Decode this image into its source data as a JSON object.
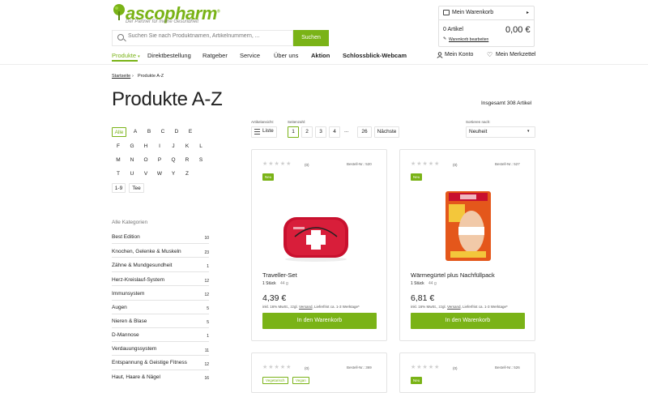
{
  "brand": {
    "name_a": "asco",
    "name_b": "pharm",
    "reg": "®",
    "tagline": "Der Partner für meine Gesundheit"
  },
  "search": {
    "placeholder": "Suchen Sie nach Produktnamen, Artikelnummern, ...",
    "button": "Suchen"
  },
  "cart": {
    "title": "Mein Warenkorb",
    "count": "0 Artikel",
    "total": "0,00 €",
    "edit": "Warenkorb bearbeiten"
  },
  "nav": {
    "items": [
      "Produkte",
      "Direktbestellung",
      "Ratgeber",
      "Service",
      "Über uns",
      "Aktion",
      "Schlossblick-Webcam"
    ],
    "account": "Mein Konto",
    "wishlist": "Mein Merkzettel"
  },
  "breadcrumb": {
    "home": "Startseite",
    "sep": "›",
    "current": "Produkte A-Z"
  },
  "page": {
    "title": "Produkte A-Z",
    "total": "Insgesamt 308 Artikel"
  },
  "letters": {
    "all": "Alle",
    "items": [
      "A",
      "B",
      "C",
      "D",
      "E",
      "F",
      "G",
      "H",
      "I",
      "J",
      "K",
      "L",
      "M",
      "N",
      "O",
      "P",
      "Q",
      "R",
      "S",
      "T",
      "U",
      "V",
      "W",
      "Y",
      "Z",
      "1-9",
      "Tee"
    ]
  },
  "categories": {
    "heading": "Alle Kategorien",
    "items": [
      {
        "name": "Best Edition",
        "count": "10"
      },
      {
        "name": "Knochen, Gelenke & Muskeln",
        "count": "23"
      },
      {
        "name": "Zähne & Mundgesundheit",
        "count": "1"
      },
      {
        "name": "Herz-Kreislauf-System",
        "count": "12"
      },
      {
        "name": "Immunsystem",
        "count": "12"
      },
      {
        "name": "Augen",
        "count": "5"
      },
      {
        "name": "Nieren & Blase",
        "count": "5"
      },
      {
        "name": "D-Mannose",
        "count": "1"
      },
      {
        "name": "Verdauungssystem",
        "count": "11"
      },
      {
        "name": "Entspannung & Geistige Fitness",
        "count": "12"
      },
      {
        "name": "Haut, Haare & Nägel",
        "count": "16"
      }
    ]
  },
  "toolbar": {
    "view_label": "Artikelansicht:",
    "view_value": "Liste",
    "page_label": "Seitenzahl:",
    "pages": [
      "1",
      "2",
      "3",
      "4",
      "...",
      "26"
    ],
    "next": "Nächste",
    "sort_label": "Sortieren nach:",
    "sort_value": "Neuheit"
  },
  "products": [
    {
      "stars": "★★★★★",
      "rating": "(0)",
      "bnr": "Bestell-Nr.: 520",
      "badge": "Neu",
      "name": "Traveller-Set",
      "qty": "1 Stück",
      "weight": "44 g",
      "price": "4,39 €",
      "info_a": "inkl. 16% MwSt., zzgl.",
      "info_link": "Versand",
      "info_b": ", Lieferfrist ca. 1-3 Werktage*",
      "button": "In den Warenkorb"
    },
    {
      "stars": "★★★★★",
      "rating": "(0)",
      "bnr": "Bestell-Nr.: 527",
      "badge": "Neu",
      "name": "Wärmegürtel plus Nachfüllpack",
      "qty": "1 Stück",
      "weight": "44 g",
      "price": "6,81 €",
      "info_a": "inkl. 16% MwSt., zzgl.",
      "info_link": "Versand",
      "info_b": ", Lieferfrist ca. 1-3 Werktage*",
      "button": "In den Warenkorb"
    },
    {
      "stars": "★★★★★",
      "rating": "(0)",
      "bnr": "Bestell-Nr.: 369",
      "badge_a": "Vegetarisch",
      "badge_b": "Vegan"
    },
    {
      "stars": "★★★★★",
      "rating": "(0)",
      "bnr": "Bestell-Nr.: 526",
      "badge": "Neu"
    }
  ],
  "colors": {
    "accent": "#7ab317"
  }
}
